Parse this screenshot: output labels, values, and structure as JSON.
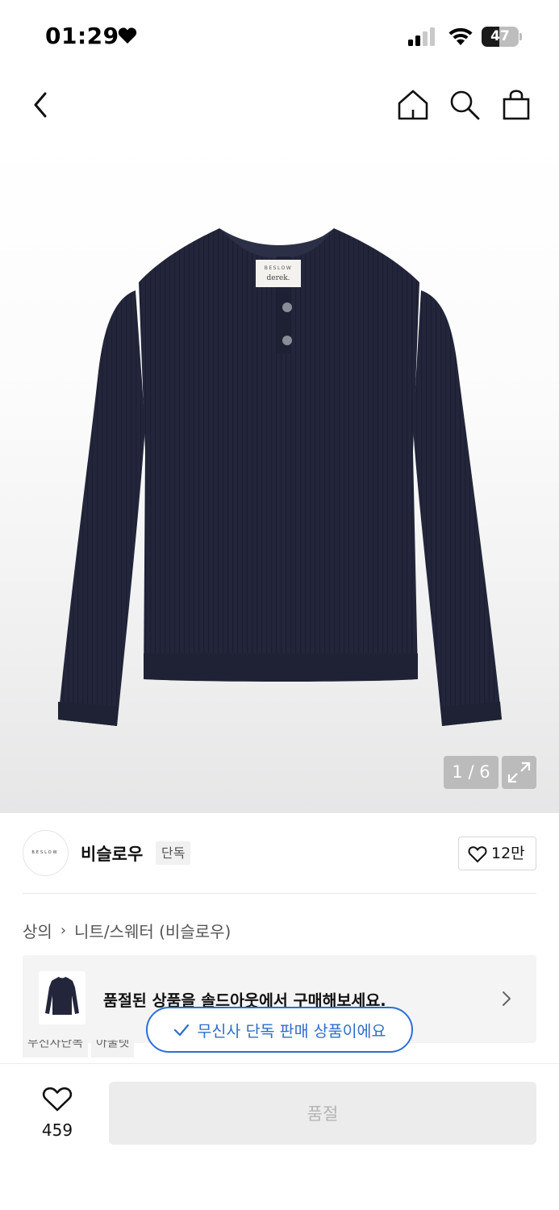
{
  "status_bar": {
    "time": "01:29",
    "battery": "47",
    "battery_level": 0.47
  },
  "nav": {
    "back_icon": "chevron-left-icon",
    "home_icon": "home-icon",
    "search_icon": "search-icon",
    "cart_icon": "shopping-bag-icon"
  },
  "product": {
    "image_counter": "1 / 6",
    "label_brand": "BESLOW",
    "label_line": "derek.",
    "sweater_color": "#23263b"
  },
  "brand": {
    "logo_text": "BESLOW",
    "name": "비슬로우",
    "badge": "단독",
    "likes": "12만"
  },
  "breadcrumb": {
    "category": "상의",
    "subcategory": "니트/스웨터 (비슬로우)"
  },
  "resale_banner": {
    "text": "품절된 상품을 솔드아웃에서 구매해보세요."
  },
  "tags": [
    "무신사단독",
    "아울렛"
  ],
  "toast": {
    "text": "무신사 단독 판매 상품이에요"
  },
  "bottom": {
    "wish_count": "459",
    "soldout_label": "품절"
  },
  "colors": {
    "accent_blue": "#2b6fd6",
    "disabled_button": "#ececec"
  }
}
